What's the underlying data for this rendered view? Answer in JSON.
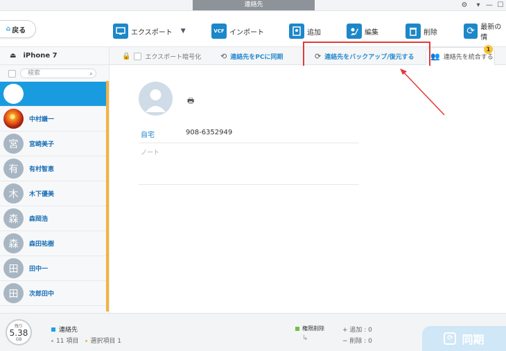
{
  "window": {
    "title": "連絡先"
  },
  "toolbar": {
    "back_label": "戻る",
    "export_label": "エクスポート",
    "import_label": "インポート",
    "add_label": "追加",
    "edit_label": "編集",
    "delete_label": "削除",
    "refresh_label": "最新の情"
  },
  "sidebar": {
    "device_name": "iPhone 7",
    "search_placeholder": "検索",
    "contacts": [
      {
        "name": "",
        "avatar": "",
        "selected": true
      },
      {
        "name": "中村謙一",
        "avatar": "",
        "photo": true
      },
      {
        "name": "宮崎美子",
        "avatar": "宮"
      },
      {
        "name": "有村智恵",
        "avatar": "有"
      },
      {
        "name": "木下優美",
        "avatar": "木"
      },
      {
        "name": "森岡浩",
        "avatar": "森"
      },
      {
        "name": "森田祐樹",
        "avatar": "森"
      },
      {
        "name": "田中一",
        "avatar": "田"
      },
      {
        "name": "次郎田中",
        "avatar": "田"
      }
    ]
  },
  "tabs": {
    "export_encrypt": "エクスポート暗号化",
    "sync_pc": "連絡先をPCに同期",
    "backup_restore": "連絡先をバックアップ/復元する",
    "merge": "連絡先を統合する",
    "merge_badge": "1"
  },
  "detail": {
    "phone_label": "自宅",
    "phone_value": "908-6352949",
    "note_placeholder": "ノート"
  },
  "status": {
    "storage_label": "残り",
    "storage_value": "5.38",
    "storage_unit": "GB",
    "contacts_title": "連絡先",
    "items_count": "11 項目",
    "selected_items": "選択項目 1",
    "permission_delete": "権限削除",
    "added_label": "追加 : 0",
    "deleted_label": "削除 : 0",
    "sync_label": "同期"
  },
  "colors": {
    "accent": "#1a9be0",
    "selection_box": "#e53935",
    "scrollbar": "#f3b341"
  }
}
